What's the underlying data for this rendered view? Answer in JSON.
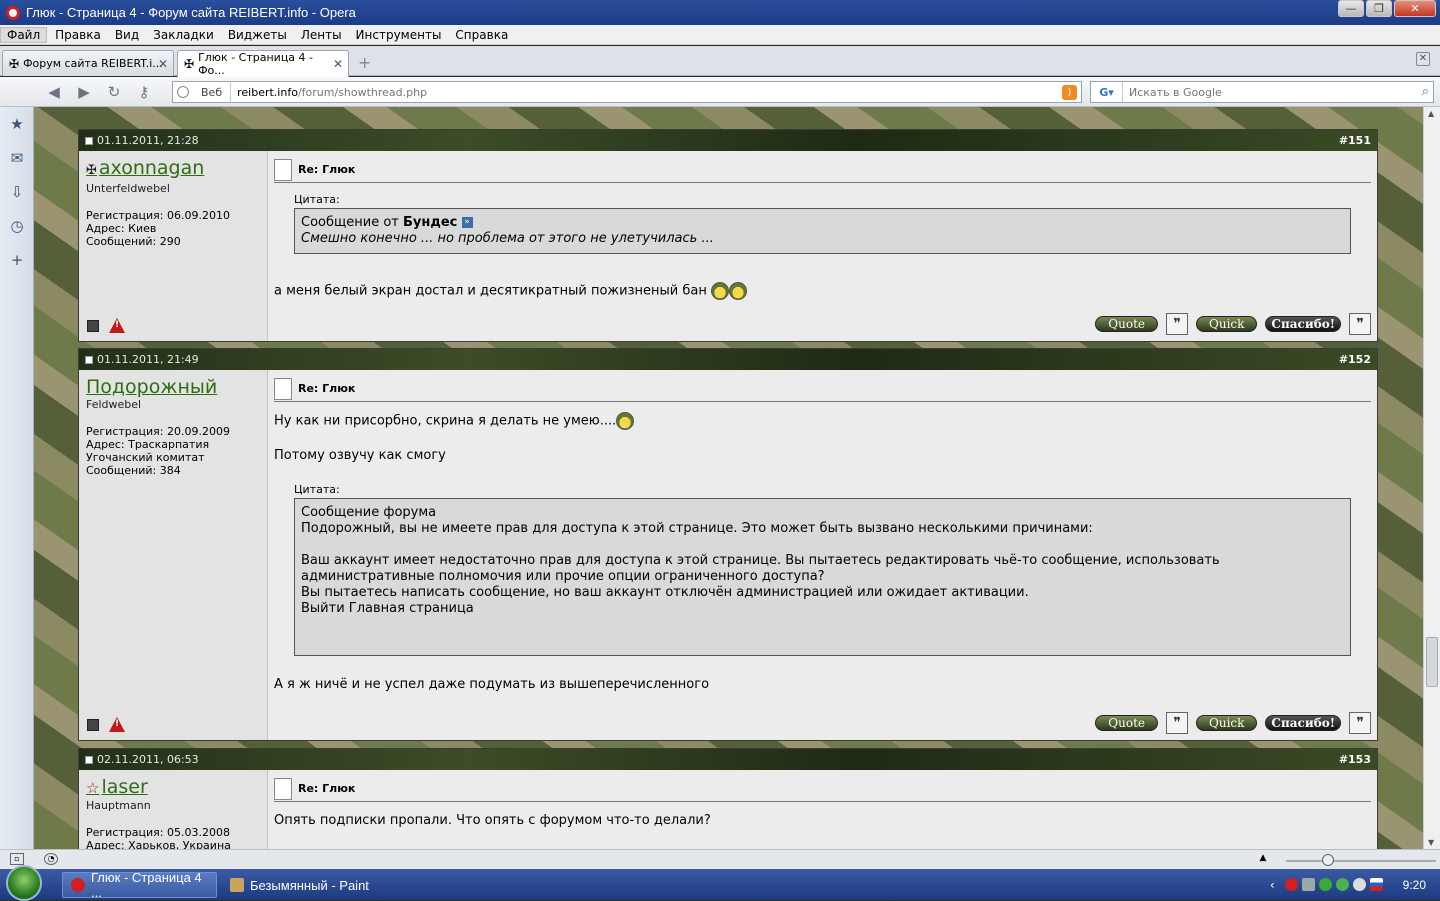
{
  "window": {
    "title": "Глюк - Страница 4 - Форум сайта REIBERT.info - Opera"
  },
  "menu": [
    "Файл",
    "Правка",
    "Вид",
    "Закладки",
    "Виджеты",
    "Ленты",
    "Инструменты",
    "Справка"
  ],
  "tabs": [
    {
      "label": "Форум сайта REIBERT.i...",
      "active": false
    },
    {
      "label": "Глюк - Страница 4 - Фо...",
      "active": true
    }
  ],
  "address": {
    "mode": "Веб",
    "host": "reibert.info",
    "path": "/forum/showthread.php"
  },
  "search": {
    "placeholder": "Искать в Google"
  },
  "posts": [
    {
      "date": "01.11.2011, 21:28",
      "number": "#151",
      "username": "axonnagan",
      "rank": "Unterfeldwebel",
      "stats": [
        "Регистрация: 06.09.2010",
        "Адрес: Киев",
        "Сообщений: 290"
      ],
      "title": "Re: Глюк",
      "quote_label": "Цитата:",
      "quote_prefix": "Сообщение от",
      "quote_author": "Бундес",
      "quote_text": "Смешно конечно ... но проблема от этого не улетучилась ...",
      "text": "а меня белый экран достал и десятикратный пожизненый бан"
    },
    {
      "date": "01.11.2011, 21:49",
      "number": "#152",
      "username": "Подорожный",
      "rank": "Feldwebel",
      "stats": [
        "Регистрация: 20.09.2009",
        "Адрес: Траскарпатия",
        "Угочанский комитат",
        "Сообщений: 384"
      ],
      "title": "Re: Глюк",
      "text1": "Ну как ни присорбно, скрина я делать не умею....",
      "text2": "Потому озвучу как смогу",
      "quote_label": "Цитата:",
      "quote_lines": [
        "Сообщение форума",
        "Подорожный, вы не имеете прав для доступа к этой странице. Это может быть вызвано несколькими причинами:",
        "",
        "Ваш аккаунт имеет недостаточно прав для доступа к этой странице. Вы пытаетесь редактировать чьё-то сообщение, использовать",
        "административные полномочия или прочие опции ограниченного доступа?",
        "Вы пытаетесь написать сообщение, но ваш аккаунт отключён администрацией или ожидает активации.",
        "Выйти Главная страница"
      ],
      "text3": "А я ж ничё и не успел даже подумать из вышеперечисленного"
    },
    {
      "date": "02.11.2011, 06:53",
      "number": "#153",
      "username": "laser",
      "rank": "Hauptmann",
      "stats": [
        "Регистрация: 05.03.2008",
        "Адрес: Харьков, Украина"
      ],
      "title": "Re: Глюк",
      "text": "Опять подписки пропали. Что опять с форумом что-то делали?"
    }
  ],
  "buttons": {
    "quote": "Quote",
    "quick": "Quick",
    "thanks": "Спасибо!"
  },
  "taskbar": {
    "items": [
      {
        "label": "Глюк - Страница 4 ...",
        "active": true
      },
      {
        "label": "Безымянный - Paint",
        "active": false
      }
    ],
    "clock": "9:20"
  }
}
